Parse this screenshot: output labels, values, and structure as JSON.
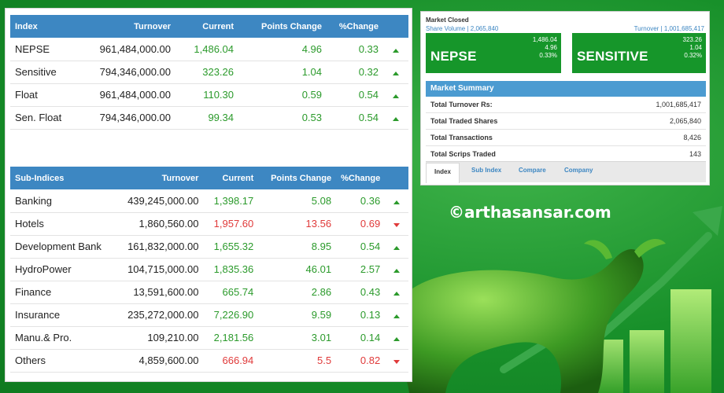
{
  "index_table": {
    "headers": [
      "Index",
      "Turnover",
      "Current",
      "Points Change",
      "%Change"
    ],
    "rows": [
      {
        "name": "NEPSE",
        "turnover": "961,484,000.00",
        "current": "1,486.04",
        "points": "4.96",
        "pct": "0.33",
        "dir": "up"
      },
      {
        "name": "Sensitive",
        "turnover": "794,346,000.00",
        "current": "323.26",
        "points": "1.04",
        "pct": "0.32",
        "dir": "up"
      },
      {
        "name": "Float",
        "turnover": "961,484,000.00",
        "current": "110.30",
        "points": "0.59",
        "pct": "0.54",
        "dir": "up"
      },
      {
        "name": "Sen. Float",
        "turnover": "794,346,000.00",
        "current": "99.34",
        "points": "0.53",
        "pct": "0.54",
        "dir": "up"
      }
    ]
  },
  "sub_table": {
    "headers": [
      "Sub-Indices",
      "Turnover",
      "Current",
      "Points Change",
      "%Change"
    ],
    "rows": [
      {
        "name": "Banking",
        "turnover": "439,245,000.00",
        "current": "1,398.17",
        "points": "5.08",
        "pct": "0.36",
        "dir": "up"
      },
      {
        "name": "Hotels",
        "turnover": "1,860,560.00",
        "current": "1,957.60",
        "points": "13.56",
        "pct": "0.69",
        "dir": "down"
      },
      {
        "name": "Development Bank",
        "turnover": "161,832,000.00",
        "current": "1,655.32",
        "points": "8.95",
        "pct": "0.54",
        "dir": "up"
      },
      {
        "name": "HydroPower",
        "turnover": "104,715,000.00",
        "current": "1,835.36",
        "points": "46.01",
        "pct": "2.57",
        "dir": "up"
      },
      {
        "name": "Finance",
        "turnover": "13,591,600.00",
        "current": "665.74",
        "points": "2.86",
        "pct": "0.43",
        "dir": "up"
      },
      {
        "name": "Insurance",
        "turnover": "235,272,000.00",
        "current": "7,226.90",
        "points": "9.59",
        "pct": "0.13",
        "dir": "up"
      },
      {
        "name": "Manu.& Pro.",
        "turnover": "109,210.00",
        "current": "2,181.56",
        "points": "3.01",
        "pct": "0.14",
        "dir": "up"
      },
      {
        "name": "Others",
        "turnover": "4,859,600.00",
        "current": "666.94",
        "points": "5.5",
        "pct": "0.82",
        "dir": "down"
      }
    ]
  },
  "market": {
    "status": "Market Closed",
    "share_volume": "Share Volume | 2,065,840",
    "turnover": "Turnover | 1,001,685,417",
    "nepse": {
      "name": "NEPSE",
      "v1": "1,486.04",
      "v2": "4.96",
      "v3": "0.33%"
    },
    "sensitive": {
      "name": "SENSITIVE",
      "v1": "323.26",
      "v2": "1.04",
      "v3": "0.32%"
    }
  },
  "summary": {
    "title": "Market Summary",
    "rows": [
      {
        "label": "Total Turnover Rs:",
        "value": "1,001,685,417"
      },
      {
        "label": "Total Traded Shares",
        "value": "2,065,840"
      },
      {
        "label": "Total Transactions",
        "value": "8,426"
      },
      {
        "label": "Total Scrips Traded",
        "value": "143"
      }
    ]
  },
  "tabs": [
    "Index",
    "Sub Index",
    "Compare",
    "Company"
  ],
  "watermark": "©arthasansar.com",
  "colors": {
    "up": "#2b9a2b",
    "down": "#e03a3a",
    "header": "#3d87c2",
    "box": "#16962a"
  }
}
